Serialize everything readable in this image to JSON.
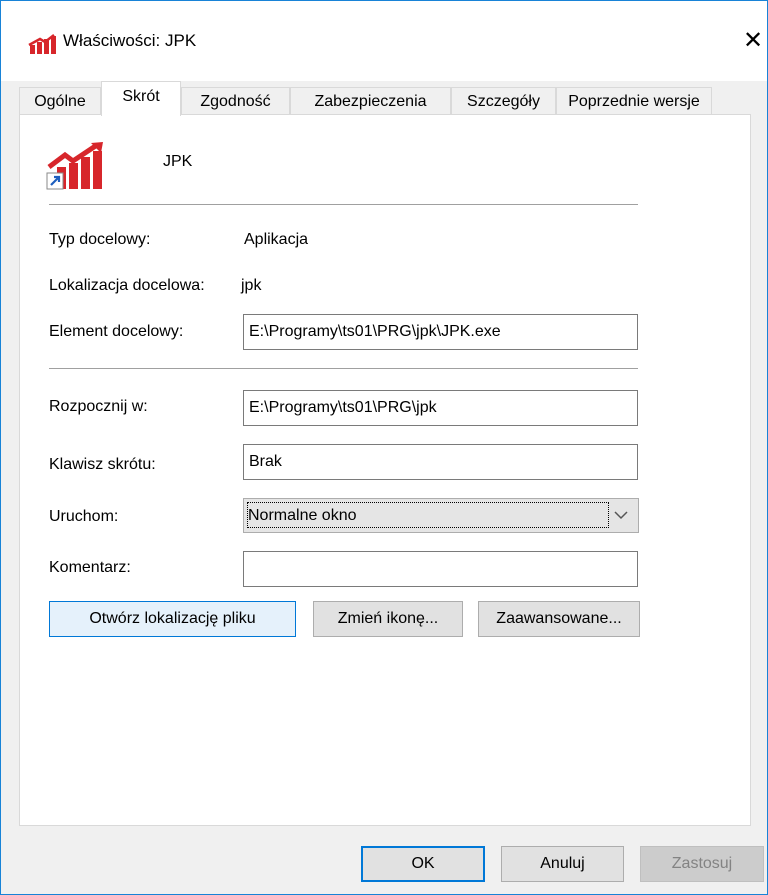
{
  "window": {
    "title": "Właściwości: JPK",
    "close_glyph": "✕"
  },
  "tabs": [
    {
      "label": "Ogólne",
      "active": false
    },
    {
      "label": "Skrót",
      "active": true
    },
    {
      "label": "Zgodność",
      "active": false
    },
    {
      "label": "Zabezpieczenia",
      "active": false
    },
    {
      "label": "Szczegóły",
      "active": false
    },
    {
      "label": "Poprzednie wersje",
      "active": false
    }
  ],
  "shortcut": {
    "name": "JPK",
    "icon": "chart-up-icon",
    "icon_color": "#d7262b"
  },
  "fields": {
    "target_type_label": "Typ docelowy:",
    "target_type_value": "Aplikacja",
    "target_location_label": "Lokalizacja docelowa:",
    "target_location_value": "jpk",
    "target_label": "Element docelowy:",
    "target_value": "E:\\Programy\\ts01\\PRG\\jpk\\JPK.exe",
    "start_in_label": "Rozpocznij w:",
    "start_in_value": "E:\\Programy\\ts01\\PRG\\jpk",
    "shortcut_key_label": "Klawisz skrótu:",
    "shortcut_key_value": "Brak",
    "run_label": "Uruchom:",
    "run_value": "Normalne okno",
    "comment_label": "Komentarz:",
    "comment_value": ""
  },
  "buttons": {
    "open_location": "Otwórz lokalizację pliku",
    "change_icon": "Zmień ikonę...",
    "advanced": "Zaawansowane..."
  },
  "footer": {
    "ok": "OK",
    "cancel": "Anuluj",
    "apply": "Zastosuj"
  },
  "colors": {
    "accent": "#0078d7",
    "window_border": "#1883d7"
  }
}
